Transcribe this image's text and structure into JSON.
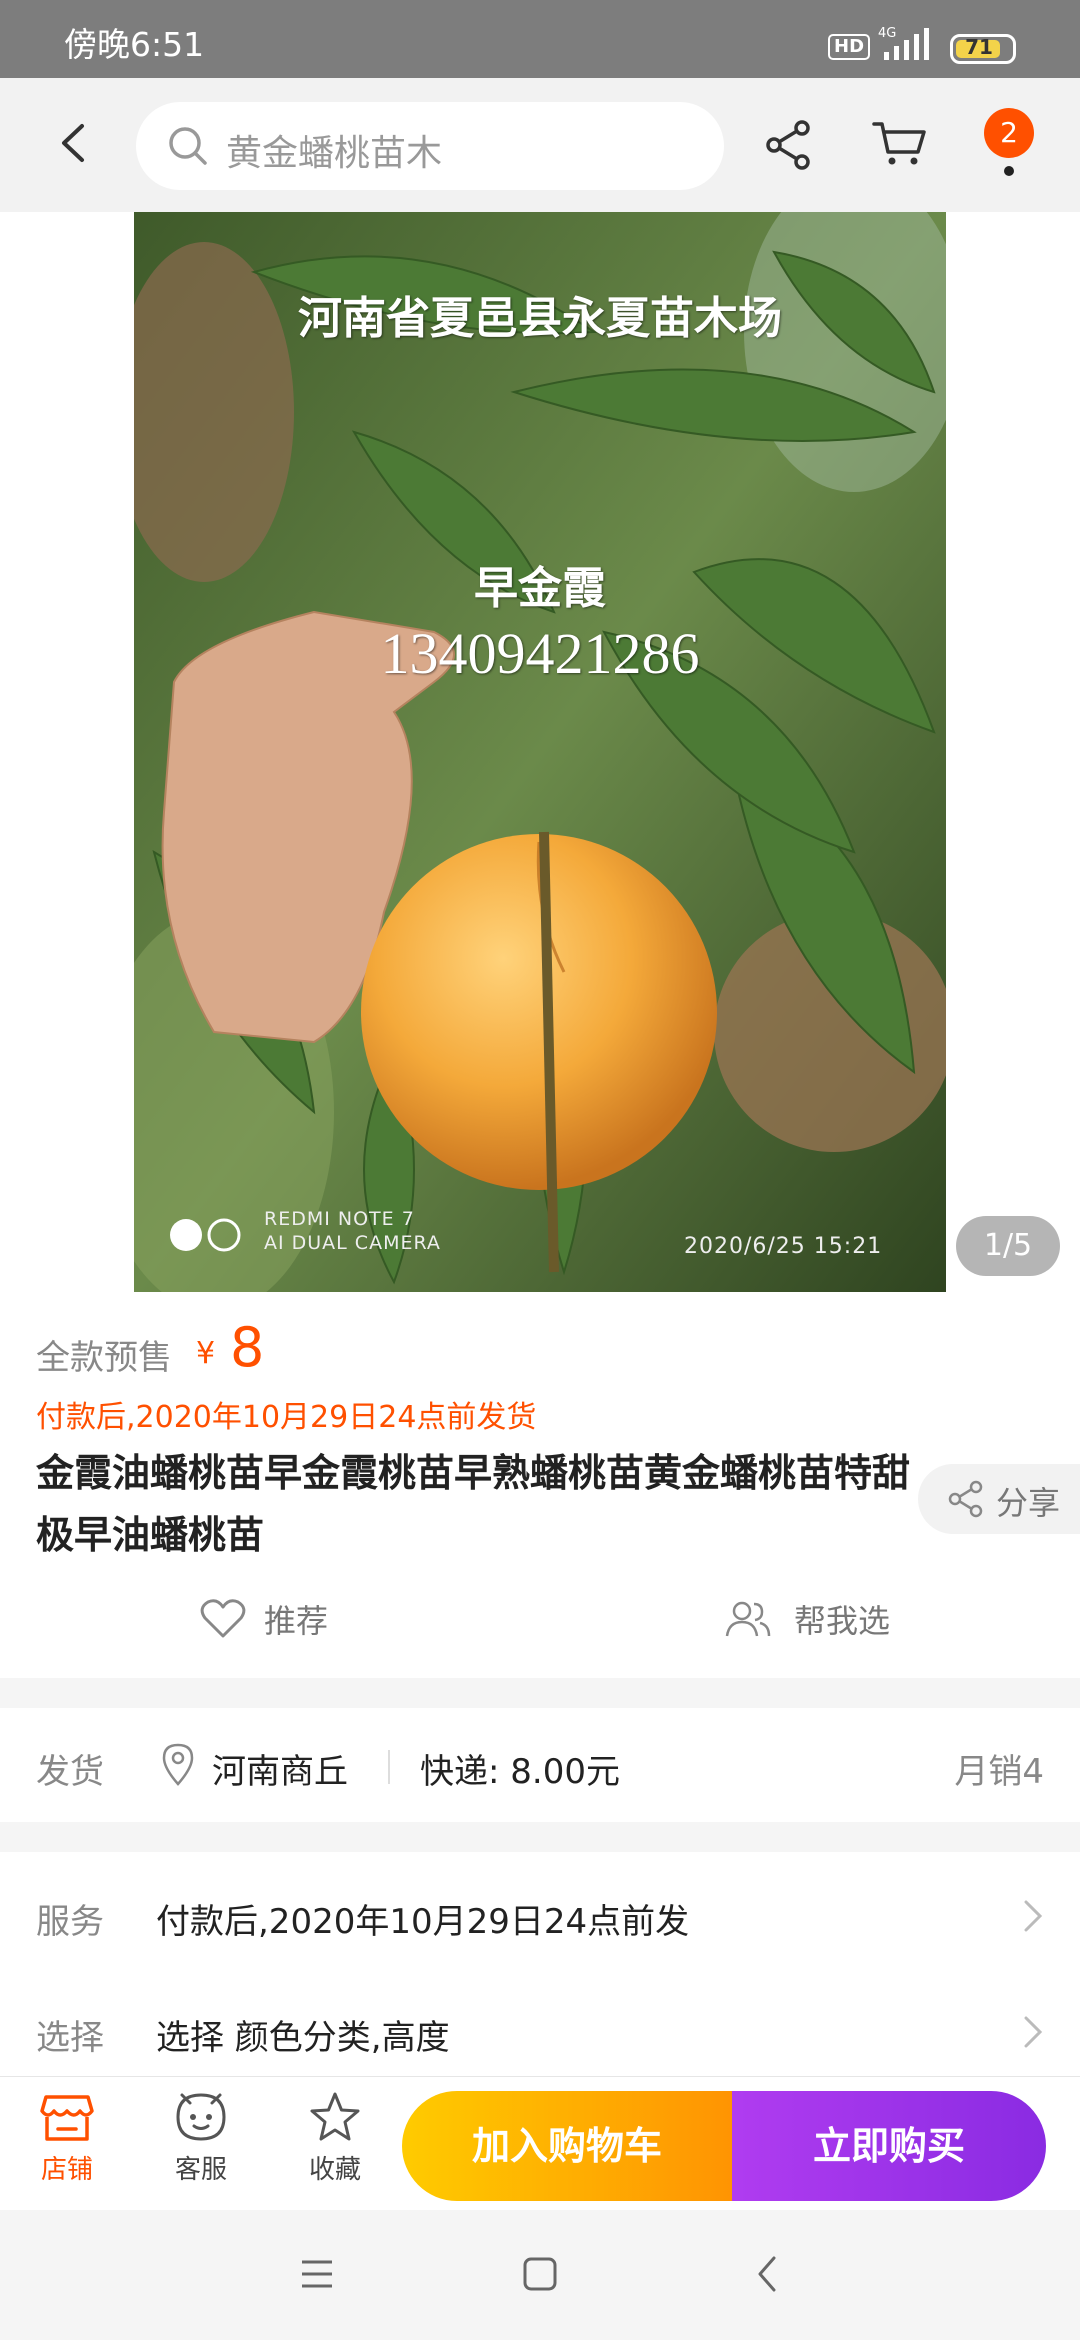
{
  "status_bar": {
    "time": "傍晚6:51",
    "hd": "HD",
    "network": "4G",
    "battery": "71"
  },
  "nav": {
    "search_placeholder": "黄金蟠桃苗木",
    "badge_count": "2"
  },
  "gallery": {
    "watermark_top": "河南省夏邑县永夏苗木场",
    "watermark_variety": "早金霞",
    "watermark_phone": "13409421286",
    "camera_line1": "REDMI NOTE 7",
    "camera_line2": "AI DUAL CAMERA",
    "timestamp": "2020/6/25  15:21",
    "pager": "1/5"
  },
  "product": {
    "presale_label": "全款预售",
    "currency": "¥",
    "price": "8",
    "ship_note": "付款后,2020年10月29日24点前发货",
    "title": "金霞油蟠桃苗早金霞桃苗早熟蟠桃苗黄金蟠桃苗特甜极早油蟠桃苗",
    "share_label": "分享",
    "recommend_label": "推荐",
    "help_choose_label": "帮我选"
  },
  "shipping": {
    "label": "发货",
    "location": "河南商丘",
    "express": "快递: 8.00元",
    "monthly_sales": "月销4"
  },
  "service": {
    "label": "服务",
    "value": "付款后,2020年10月29日24点前发"
  },
  "select": {
    "label": "选择",
    "value": "选择 颜色分类,高度"
  },
  "action_bar": {
    "store_label": "店铺",
    "service_label": "客服",
    "favorite_label": "收藏",
    "add_to_cart": "加入购物车",
    "buy_now": "立即购买"
  },
  "colors": {
    "accent": "#ff5000",
    "cart_gradient": "#ffcb00",
    "buy_gradient": "#8a2be2"
  }
}
